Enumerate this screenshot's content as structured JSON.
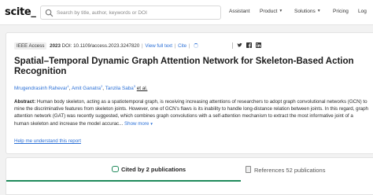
{
  "header": {
    "logo": "scite_",
    "search_placeholder": "Search by title, author, keywords or DOI",
    "nav": [
      {
        "label": "Assistant",
        "dropdown": false
      },
      {
        "label": "Product",
        "dropdown": true
      },
      {
        "label": "Solutions",
        "dropdown": true
      },
      {
        "label": "Pricing",
        "dropdown": false
      },
      {
        "label": "Log",
        "dropdown": false
      }
    ]
  },
  "article": {
    "publisher_badge": "IEEE Access",
    "year": "2023",
    "doi": "DOI: 10.1109/access.2023.3247820",
    "view_full_text": "View full text",
    "cite": "Cite",
    "title": "Spatial–Temporal Dynamic Graph Attention Network for Skeleton-Based Action Recognition",
    "authors": [
      {
        "name": "Mrugendrasinh Rahevar",
        "sup": "1"
      },
      {
        "name": "Amit Ganatra",
        "sup": "2"
      },
      {
        "name": "Tanzila Saba",
        "sup": "3"
      }
    ],
    "et_al": "et al.",
    "abstract_label": "Abstract:",
    "abstract_text": "Human body skeleton, acting as a spatiotemporal graph, is receiving increasing attentions of researchers to adopt graph convolutional networks (GCN) to mine the discriminative features from skeleton joints. However, one of GCN's flaws is its inability to handle long-distance relation between joints. In this regard, graph attention network (GAT) was recently suggested, which combines graph convolutions with a self-attention mechanism to extract the most informative joint of a human skeleton and increase the model accurac...",
    "show_more": "Show more",
    "help_link": "Help me understand this report"
  },
  "tabs": {
    "cited_by": "Cited by 2 publications",
    "references": "References 52 publications"
  },
  "colors": {
    "link": "#2a6fd6",
    "accent_green": "#1f8a5b"
  }
}
